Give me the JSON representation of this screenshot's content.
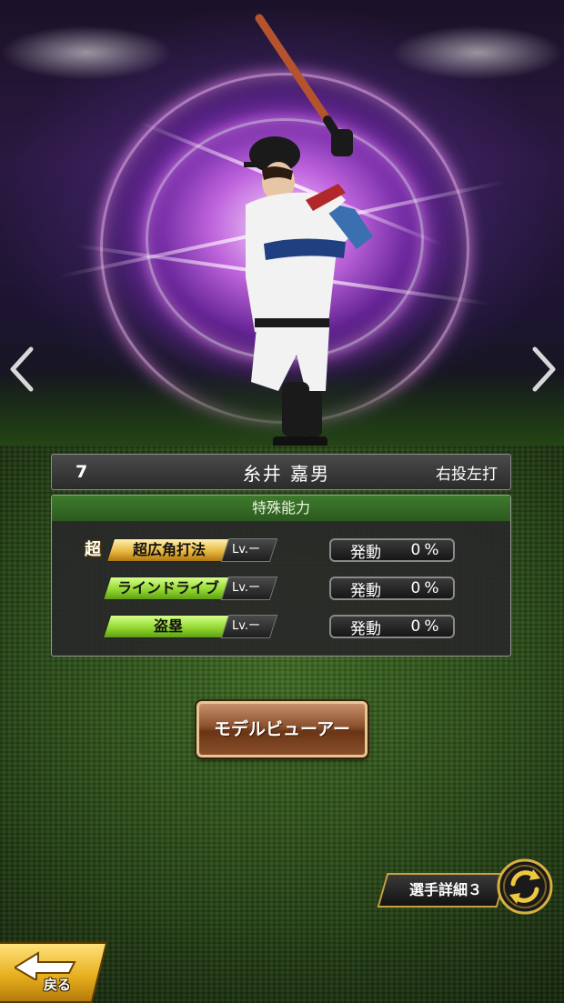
{
  "player": {
    "number": "7",
    "name": "糸井 嘉男",
    "handedness": "右投左打"
  },
  "abilities_panel": {
    "title": "特殊能力",
    "abilities": [
      {
        "super_mark": "超",
        "name": "超広角打法",
        "level": "Lv.ー",
        "status_label": "発動",
        "rate": "0%",
        "tier": "gold"
      },
      {
        "super_mark": "",
        "name": "ラインドライブ",
        "level": "Lv.ー",
        "status_label": "発動",
        "rate": "0%",
        "tier": "green"
      },
      {
        "super_mark": "",
        "name": "盗塁",
        "level": "Lv.ー",
        "status_label": "発動",
        "rate": "0%",
        "tier": "green"
      }
    ]
  },
  "buttons": {
    "model_viewer": "モデルビューアー",
    "player_detail": "選手詳細３",
    "back": "戻る"
  },
  "icons": {
    "prev": "chevron-left-icon",
    "next": "chevron-right-icon",
    "cycle": "cycle-arrows-icon",
    "back": "back-arrow-icon"
  },
  "colors": {
    "panel_header": "#2b5a1f",
    "gold_badge": "#e8b840",
    "green_badge": "#8ed42c",
    "button_brown": "#8a4f2c",
    "accent_gold": "#c8a040"
  }
}
